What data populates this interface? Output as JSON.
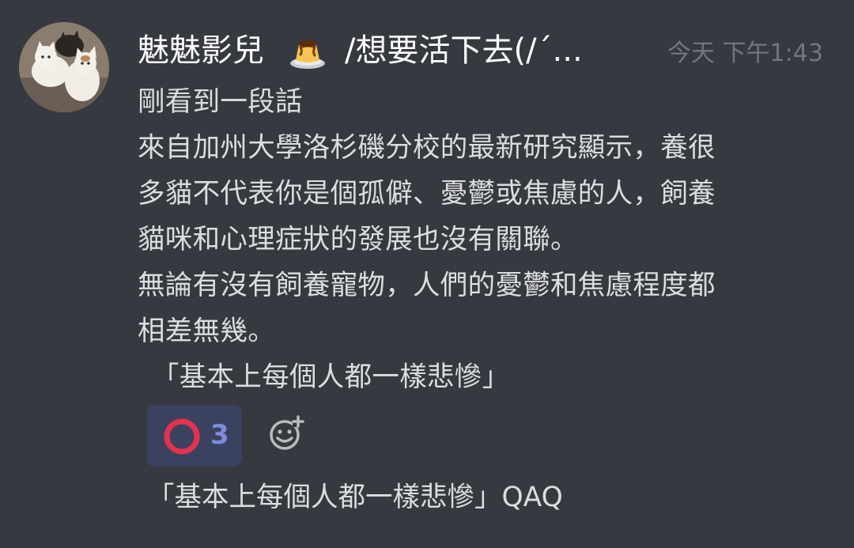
{
  "message": {
    "author": {
      "display_name": "魅魅影兒",
      "name_emoji_icon": "pudding-icon",
      "name_suffix": "/想要活下去(/´...",
      "avatar": "cats-avatar"
    },
    "timestamp": "今天 下午1:43",
    "lines": [
      "剛看到一段話",
      "來自加州大學洛杉磯分校的最新研究顯示，養很",
      "多貓不代表你是個孤僻、憂鬱或焦慮的人，飼養",
      "貓咪和心理症狀的發展也沒有關聯。",
      "無論有沒有飼養寵物，人們的憂鬱和焦慮程度都",
      "相差無幾。",
      "「基本上每個人都一樣悲慘」"
    ],
    "reactions": [
      {
        "emoji_icon": "red-circle-icon",
        "count": "3",
        "color": "#e2324f"
      }
    ],
    "add_reaction_icon": "add-reaction-icon"
  },
  "reply": {
    "text": "「基本上每個人都一樣悲慘」QAQ"
  },
  "colors": {
    "background": "#36393f",
    "text": "#dcddde",
    "username": "#ffffff",
    "timestamp": "#72767d",
    "reaction_bg": "#3b4260",
    "reaction_count": "#7f8cde"
  }
}
